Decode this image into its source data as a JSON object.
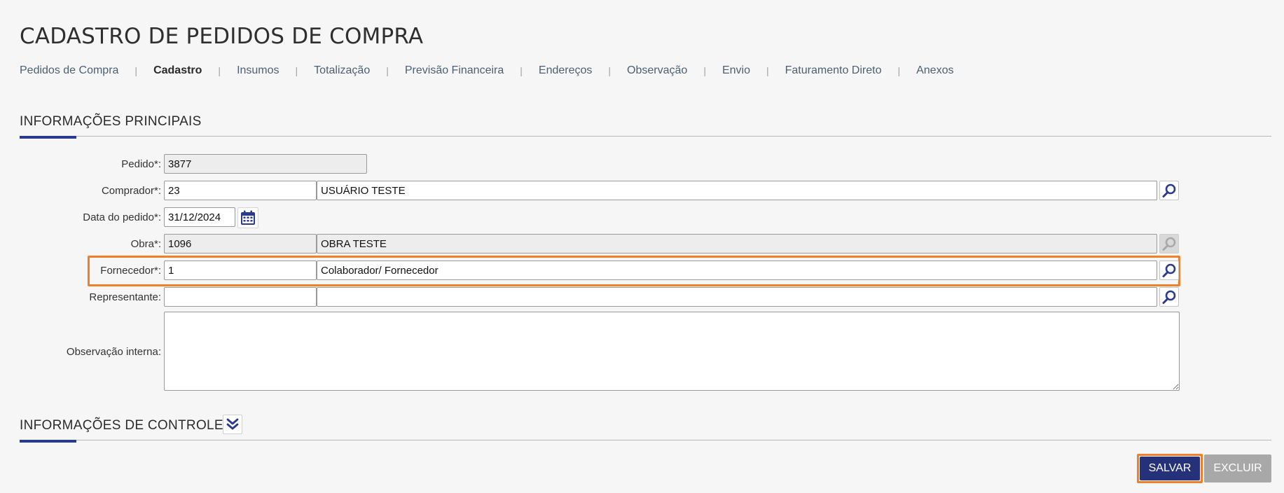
{
  "page_title": "CADASTRO DE PEDIDOS DE COMPRA",
  "tabs": [
    {
      "label": "Pedidos de Compra"
    },
    {
      "label": "Cadastro"
    },
    {
      "label": "Insumos"
    },
    {
      "label": "Totalização"
    },
    {
      "label": "Previsão Financeira"
    },
    {
      "label": "Endereços"
    },
    {
      "label": "Observação"
    },
    {
      "label": "Envio"
    },
    {
      "label": "Faturamento Direto"
    },
    {
      "label": "Anexos"
    }
  ],
  "active_tab": "Cadastro",
  "tab_separator": "|",
  "section_main": {
    "title": "INFORMAÇÕES PRINCIPAIS"
  },
  "fields": {
    "pedido": {
      "label": "Pedido*:",
      "value": "3877"
    },
    "comprador": {
      "label": "Comprador*:",
      "code": "23",
      "name": "USUÁRIO TESTE"
    },
    "data_pedido": {
      "label": "Data do pedido*:",
      "value": "31/12/2024"
    },
    "obra": {
      "label": "Obra*:",
      "code": "1096",
      "name": "OBRA TESTE"
    },
    "fornecedor": {
      "label": "Fornecedor*:",
      "code": "1",
      "name": "Colaborador/ Fornecedor"
    },
    "representante": {
      "label": "Representante:",
      "code": "",
      "name": ""
    },
    "observacao_interna": {
      "label": "Observação interna:",
      "value": ""
    }
  },
  "section_control": {
    "title": "INFORMAÇÕES DE CONTROLE"
  },
  "buttons": {
    "save": "SALVAR",
    "delete": "EXCLUIR"
  },
  "colors": {
    "accent": "#2a3a8f",
    "highlight": "#f07f2a",
    "save_bg": "#253178",
    "delete_bg": "#a8a8a8"
  },
  "icons": {
    "lookup": "search-icon",
    "calendar": "calendar-icon",
    "expand": "chevron-double-down-icon"
  }
}
